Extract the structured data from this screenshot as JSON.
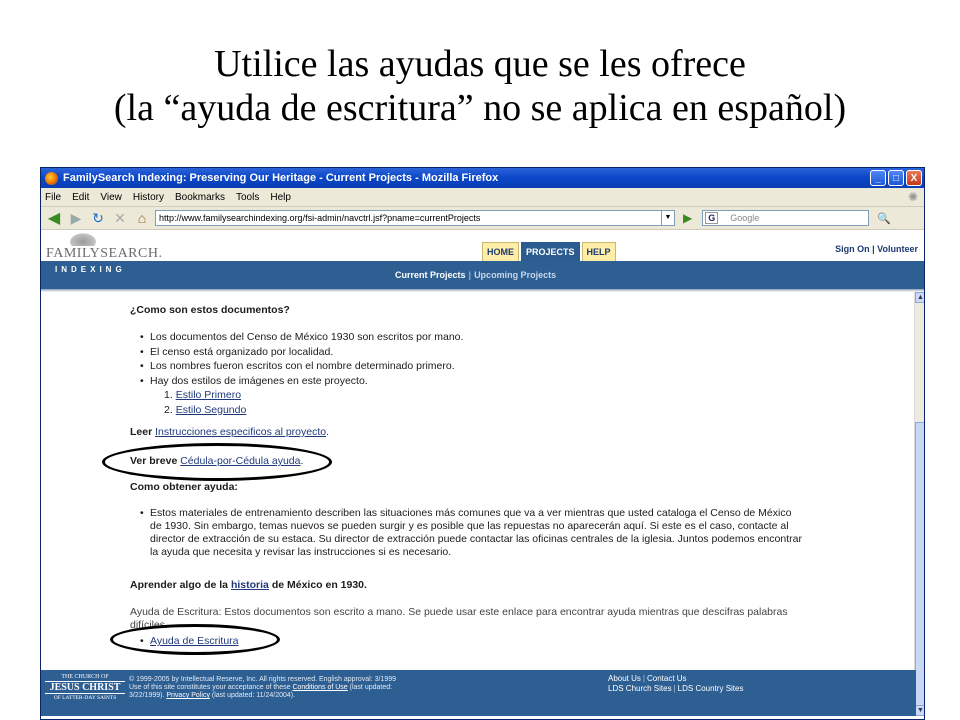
{
  "slide": {
    "title_line1": "Utilice las ayudas que se les ofrece",
    "title_line2": "(la “ayuda de escritura” no se aplica en español)"
  },
  "window": {
    "title": "FamilySearch Indexing: Preserving Our Heritage - Current Projects - Mozilla Firefox",
    "buttons": [
      "_",
      "□",
      "X"
    ]
  },
  "menu": [
    "File",
    "Edit",
    "View",
    "History",
    "Bookmarks",
    "Tools",
    "Help"
  ],
  "nav": {
    "url": "http://www.familysearchindexing.org/fsi-admin/navctrl.jsf?pname=currentProjects",
    "search_placeholder": "Google",
    "search_engine": "G"
  },
  "site": {
    "logo": "FAMILYSEARCH.",
    "tabs": [
      "HOME",
      "PROJECTS",
      "HELP"
    ],
    "active_tab": "PROJECTS",
    "sign_on": "Sign On",
    "separator": "|",
    "volunteer": "Volunteer",
    "section": "INDEXING",
    "sub_current": "Current Projects",
    "sub_upcoming": "Upcoming Projects"
  },
  "content": {
    "h1": "¿Como son estos documentos?",
    "bullets1": [
      "Los documentos del Censo de México 1930 son escritos por mano.",
      "El censo está organizado por localidad.",
      "Los nombres fueron escritos con el nombre determinado primero.",
      "Hay dos estilos de imágenes en este proyecto."
    ],
    "styles": [
      {
        "num": "1.",
        "label": "Estilo Primero"
      },
      {
        "num": "2.",
        "label": "Estilo Segundo"
      }
    ],
    "leer_prefix": "Leer",
    "leer_link": "Instrucciones especificos al proyecto",
    "leer_suffix": ".",
    "ver_prefix": "Ver breve",
    "ver_link": "Cédula-por-Cédula ayuda",
    "ver_suffix": ".",
    "h2": "Como obtener ayuda:",
    "help_paragraph_lines": [
      "Estos materiales de entrenamiento describen las situaciones más comunes que va a ver mientras que usted cataloga el Censo de México",
      "de 1930. Sin embargo, temas nuevos se pueden surgir y es posible que las repuestas no aparecerán aquí. Si este es el caso, contacte al",
      "director de extracción de su estaca. Su director de extracción puede contactar las oficinas centrales de la iglesia. Juntos podemos encontrar",
      "la ayuda que necesita y revisar las instrucciones si es necesario."
    ],
    "learn_prefix": "Aprender algo de la",
    "learn_link": "historia",
    "learn_suffix": "de México en 1930.",
    "writing_help_lines": [
      "Ayuda de Escritura: Estos documentos son escrito a mano. Se puede usar este enlace para encontrar ayuda mientras que descifras palabras",
      "difíciles."
    ],
    "writing_help_link": "Ayuda de Escritura"
  },
  "footer": {
    "logo_top": "THE CHURCH OF",
    "logo_main": "JESUS CHRIST",
    "logo_bottom": "OF LATTER-DAY SAINTS",
    "legal_line1": "© 1999-2005 by Intellectual Reserve, Inc.  All rights reserved.  English approval: 3/1999",
    "legal_line2_prefix": "Use of this site constitutes your acceptance of these",
    "legal_terms_link": "Conditions of Use",
    "legal_line2_suffix": "(last updated:",
    "legal_line3_prefix": "3/22/1999).",
    "legal_privacy_link": "Privacy Policy",
    "legal_line3_suffix": "(last updated: 11/24/2004).",
    "about": "About Us",
    "contact": "Contact Us",
    "church_sites": "LDS Church Sites",
    "country_sites": "LDS Country Sites",
    "separator": "|"
  }
}
